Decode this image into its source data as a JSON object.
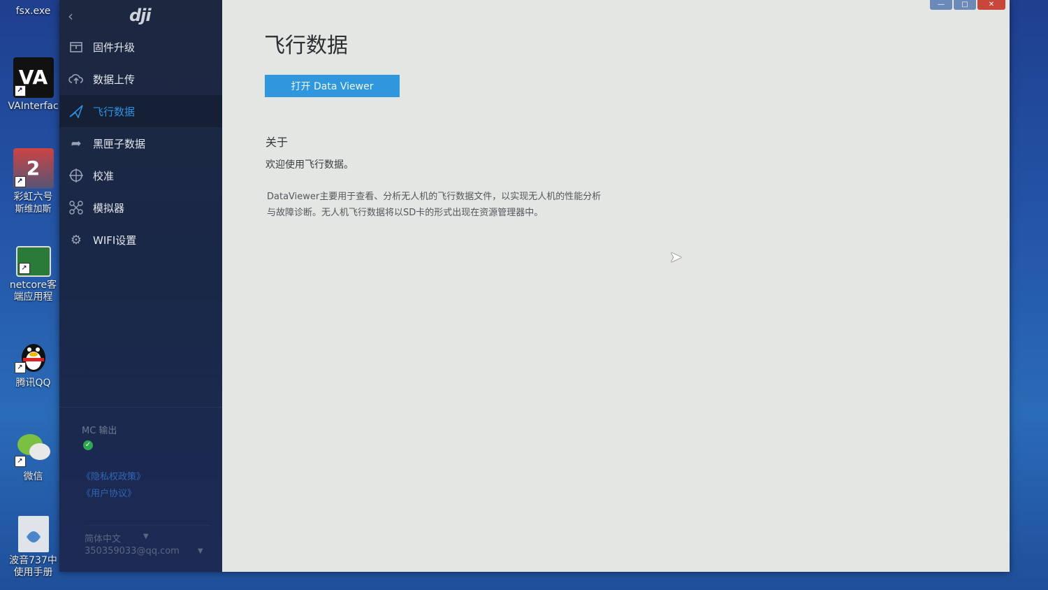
{
  "desktop": {
    "icons": [
      {
        "label": "fsx.exe"
      },
      {
        "label": "VAInterfac",
        "badge": "VA"
      },
      {
        "label": "彩虹六号",
        "sub": "斯维加斯",
        "badge": "2"
      },
      {
        "label": "netcore客",
        "sub": "端应用程"
      },
      {
        "label": "腾讯QQ"
      },
      {
        "label": "微信"
      },
      {
        "label": "波音737中",
        "sub": "使用手册"
      }
    ]
  },
  "sidebar": {
    "logo": "dji",
    "items": [
      {
        "label": "固件升级",
        "icon": "box-icon"
      },
      {
        "label": "数据上传",
        "icon": "cloud-upload-icon"
      },
      {
        "label": "飞行数据",
        "icon": "plane-icon",
        "active": true
      },
      {
        "label": "黑匣子数据",
        "icon": "share-arrow-icon"
      },
      {
        "label": "校准",
        "icon": "target-icon"
      },
      {
        "label": "模拟器",
        "icon": "drone-icon"
      },
      {
        "label": "WIFI设置",
        "icon": "gear-icon"
      }
    ],
    "mc_label": "MC 输出",
    "privacy_link": "《隐私权政策》",
    "terms_link": "《用户协议》",
    "language": "简体中文",
    "account": "350359033@qq.com"
  },
  "main": {
    "title": "飞行数据",
    "open_button": "打开 Data Viewer",
    "about_title": "关于",
    "welcome": "欢迎使用飞行数据。",
    "description": "DataViewer主要用于查看、分析无人机的飞行数据文件，以实现无人机的性能分析与故障诊断。无人机飞行数据将以SD卡的形式出现在资源管理器中。"
  },
  "colors": {
    "accent": "#2e97dd",
    "sidebar_bg": "#1c2740",
    "active_text": "#2f8fe0"
  }
}
